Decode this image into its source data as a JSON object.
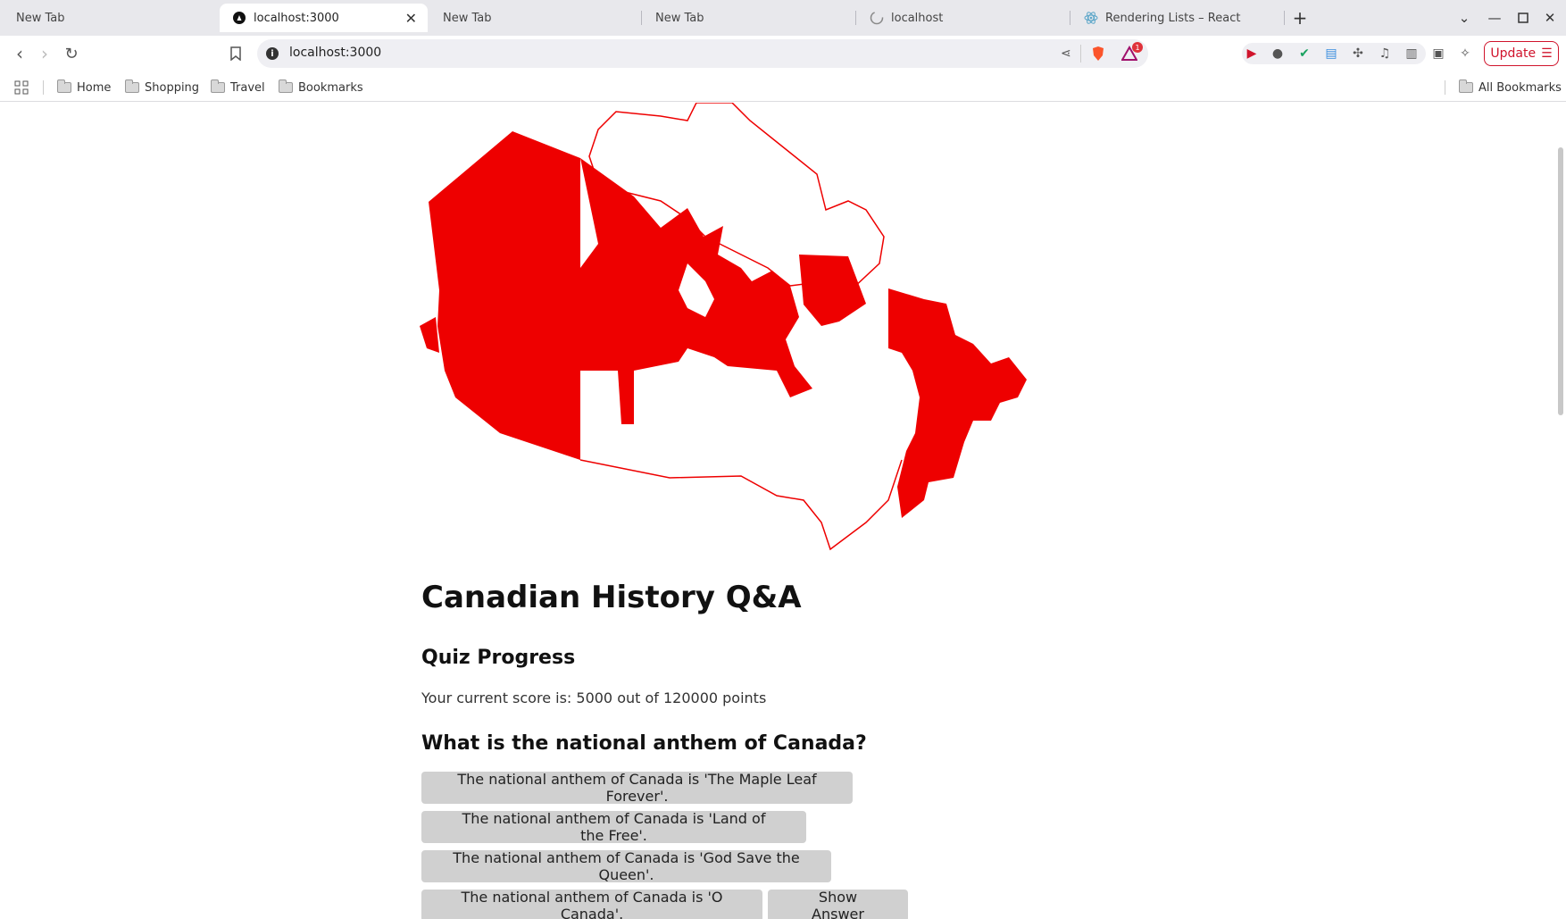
{
  "tabs": [
    {
      "label": "New Tab"
    },
    {
      "label": "localhost:3000"
    },
    {
      "label": "New Tab"
    },
    {
      "label": "New Tab"
    },
    {
      "label": "localhost"
    },
    {
      "label": "Rendering Lists – React"
    }
  ],
  "toolbar": {
    "url": "localhost:3000",
    "update_label": "Update",
    "brave_badge": "1"
  },
  "bookmarks": {
    "items": [
      "Home",
      "Shopping",
      "Travel",
      "Bookmarks"
    ],
    "all_label": "All Bookmarks"
  },
  "page": {
    "title": "Canadian History Q&A",
    "progress_heading": "Quiz Progress",
    "score_text": "Your current score is: 5000 out of 120000 points",
    "question": "What is the national anthem of Canada?",
    "answers": [
      "The national anthem of Canada is 'The Maple Leaf Forever'.",
      "The national anthem of Canada is 'Land of the Free'.",
      "The national anthem of Canada is 'God Save the Queen'.",
      "The national anthem of Canada is 'O Canada'."
    ],
    "show_answer_label": "Show Answer"
  },
  "colors": {
    "flag_red": "#ee0000",
    "button_gray": "#d0d0d0"
  }
}
